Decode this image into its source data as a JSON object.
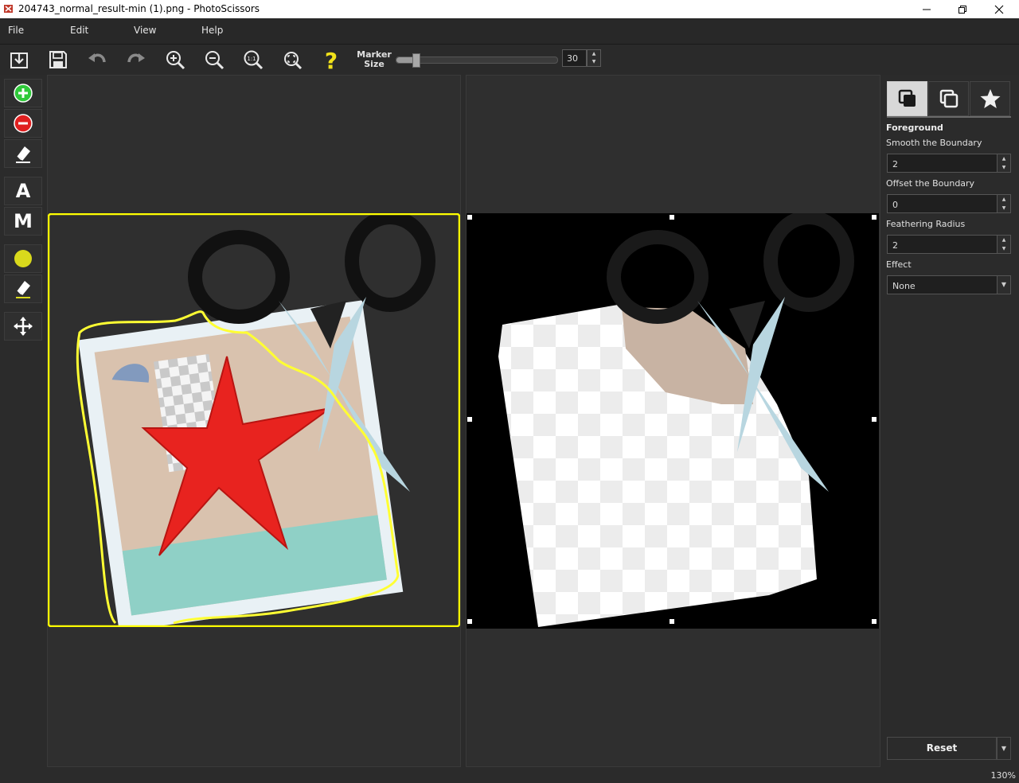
{
  "window": {
    "title": "204743_normal_result-min (1).png - PhotoScissors",
    "icons": [
      "app-icon",
      "minimize-icon",
      "restore-icon",
      "close-icon"
    ]
  },
  "menu": {
    "file": "File",
    "edit": "Edit",
    "view": "View",
    "help": "Help"
  },
  "toolbar": {
    "marker_label_1": "Marker",
    "marker_label_2": "Size",
    "marker_size_value": "30",
    "marker_size_level": 0.12,
    "icons": [
      "open-icon",
      "save-icon",
      "undo-icon",
      "redo-icon",
      "zoom-in-icon",
      "zoom-out-icon",
      "zoom-actual-icon",
      "zoom-fit-icon",
      "help-icon"
    ]
  },
  "tools": {
    "letter_a": "A",
    "letter_m": "M",
    "icons": [
      "add-marker-icon",
      "remove-marker-icon",
      "eraser-icon",
      "boundary-marker-icon",
      "boundary-eraser-icon",
      "move-icon"
    ],
    "colors": {
      "green": "#2fc93a",
      "red": "#e02020",
      "yellow": "#d9d91c"
    }
  },
  "panel": {
    "section_title": "Foreground",
    "smooth_label": "Smooth the Boundary",
    "smooth_value": "2",
    "offset_label": "Offset the Boundary",
    "offset_value": "0",
    "feather_label": "Feathering Radius",
    "feather_value": "2",
    "effect_label": "Effect",
    "effect_value": "None",
    "reset_label": "Reset",
    "tab_icons": [
      "foreground-tab-icon",
      "background-tab-icon",
      "effects-tab-icon"
    ]
  },
  "status": {
    "zoom": "130%"
  }
}
